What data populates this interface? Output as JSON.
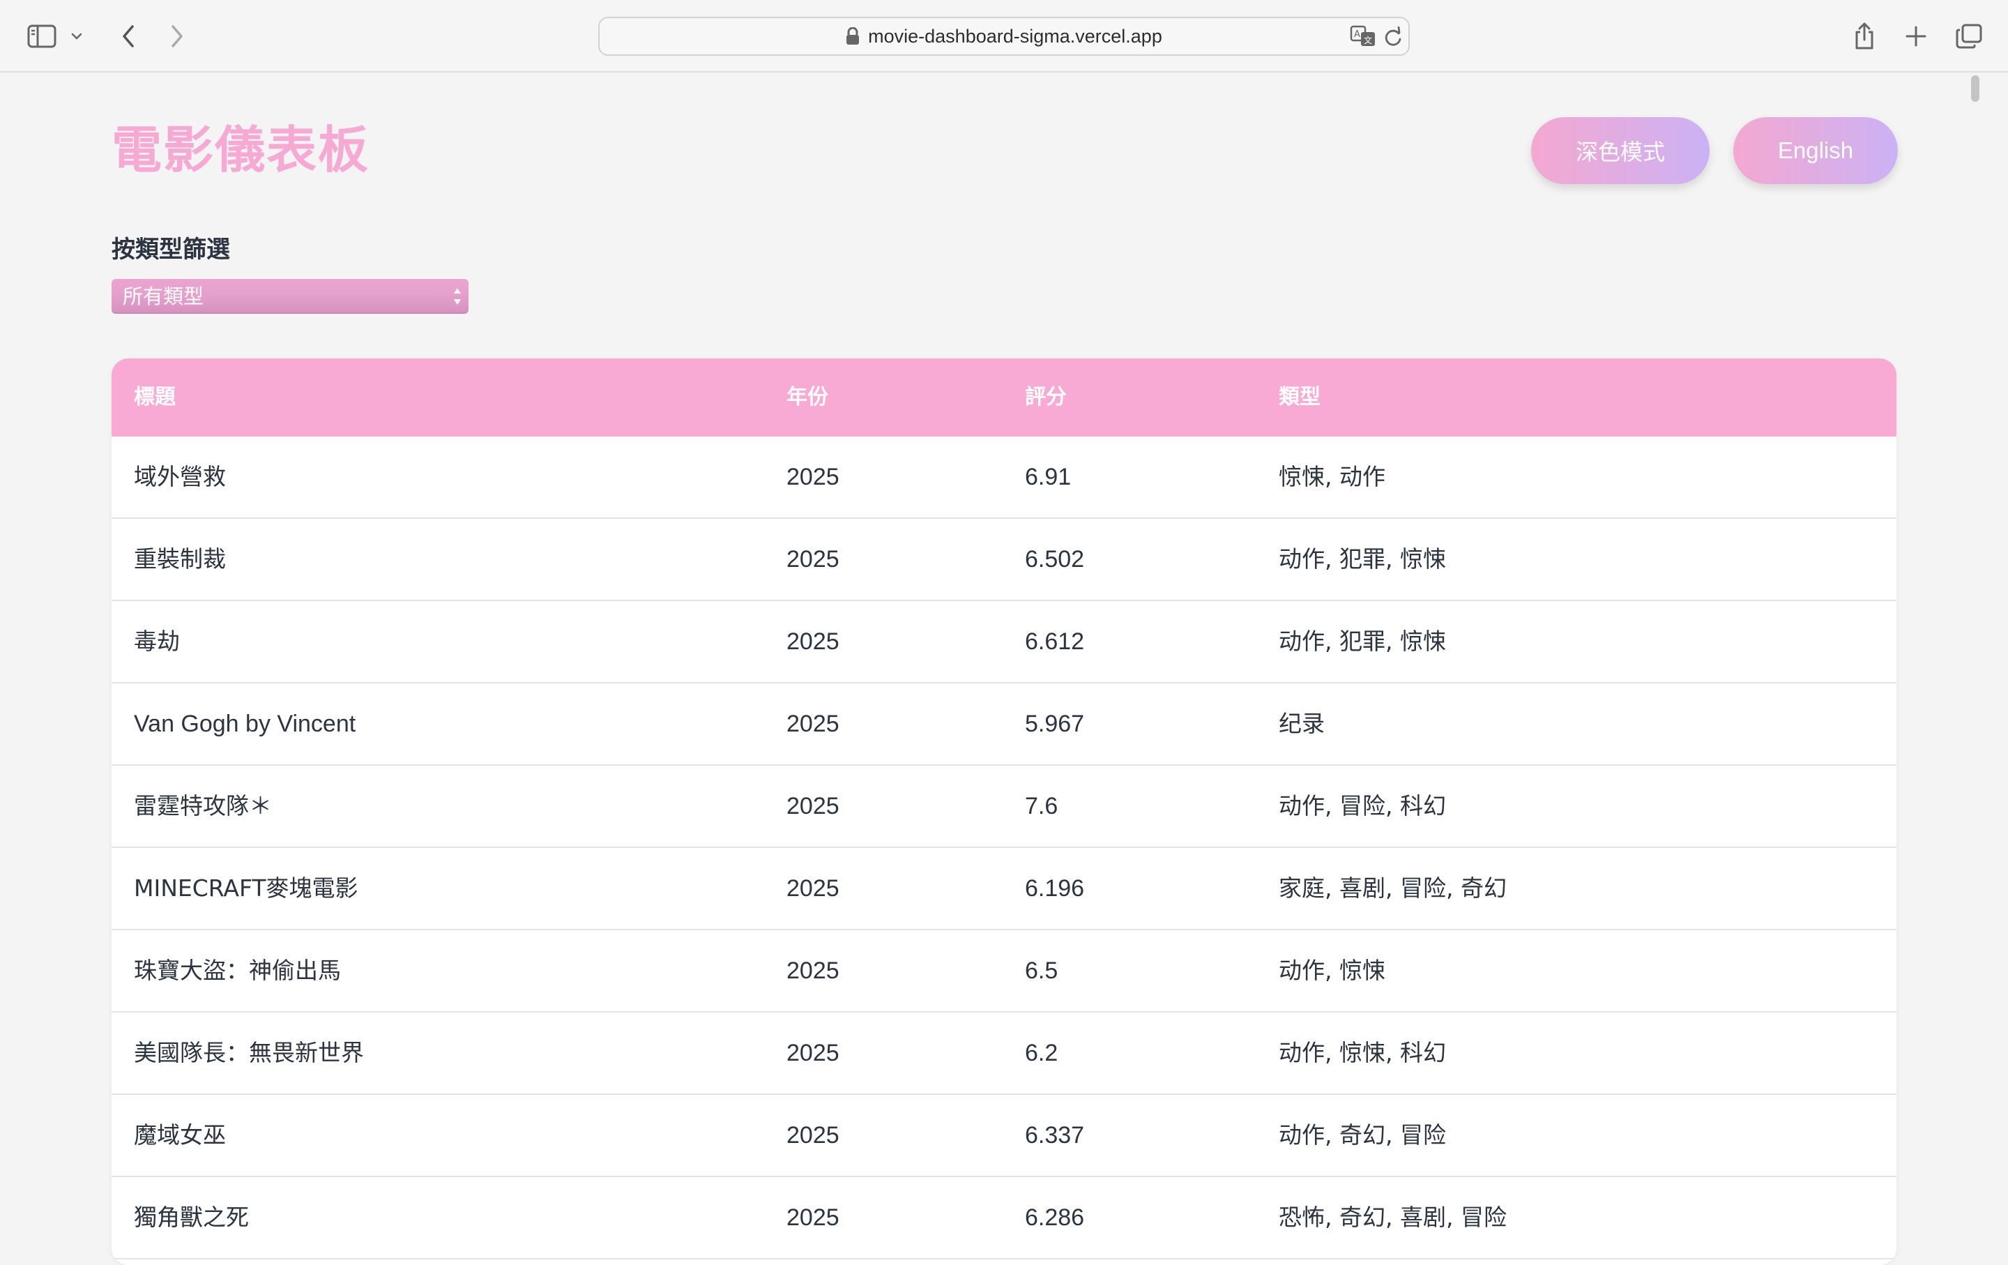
{
  "browser": {
    "url": "movie-dashboard-sigma.vercel.app"
  },
  "header": {
    "title": "電影儀表板",
    "dark_mode_label": "深色模式",
    "language_label": "English"
  },
  "filter": {
    "label": "按類型篩選",
    "selected": "所有類型"
  },
  "table": {
    "columns": [
      "標題",
      "年份",
      "評分",
      "類型"
    ],
    "rows": [
      {
        "title": "域外營救",
        "year": "2025",
        "rating": "6.91",
        "genres": "惊悚, 动作"
      },
      {
        "title": "重裝制裁",
        "year": "2025",
        "rating": "6.502",
        "genres": "动作, 犯罪, 惊悚"
      },
      {
        "title": "毒劫",
        "year": "2025",
        "rating": "6.612",
        "genres": "动作, 犯罪, 惊悚"
      },
      {
        "title": "Van Gogh by Vincent",
        "year": "2025",
        "rating": "5.967",
        "genres": "纪录"
      },
      {
        "title": "雷霆特攻隊＊",
        "year": "2025",
        "rating": "7.6",
        "genres": "动作, 冒险, 科幻"
      },
      {
        "title": "MINECRAFT麥塊電影",
        "year": "2025",
        "rating": "6.196",
        "genres": "家庭, 喜剧, 冒险, 奇幻"
      },
      {
        "title": "珠寶大盜：神偷出馬",
        "year": "2025",
        "rating": "6.5",
        "genres": "动作, 惊悚"
      },
      {
        "title": "美國隊長：無畏新世界",
        "year": "2025",
        "rating": "6.2",
        "genres": "动作, 惊悚, 科幻"
      },
      {
        "title": "魔域女巫",
        "year": "2025",
        "rating": "6.337",
        "genres": "动作, 奇幻, 冒险"
      },
      {
        "title": "獨角獸之死",
        "year": "2025",
        "rating": "6.286",
        "genres": "恐怖, 奇幻, 喜剧, 冒险"
      }
    ]
  }
}
